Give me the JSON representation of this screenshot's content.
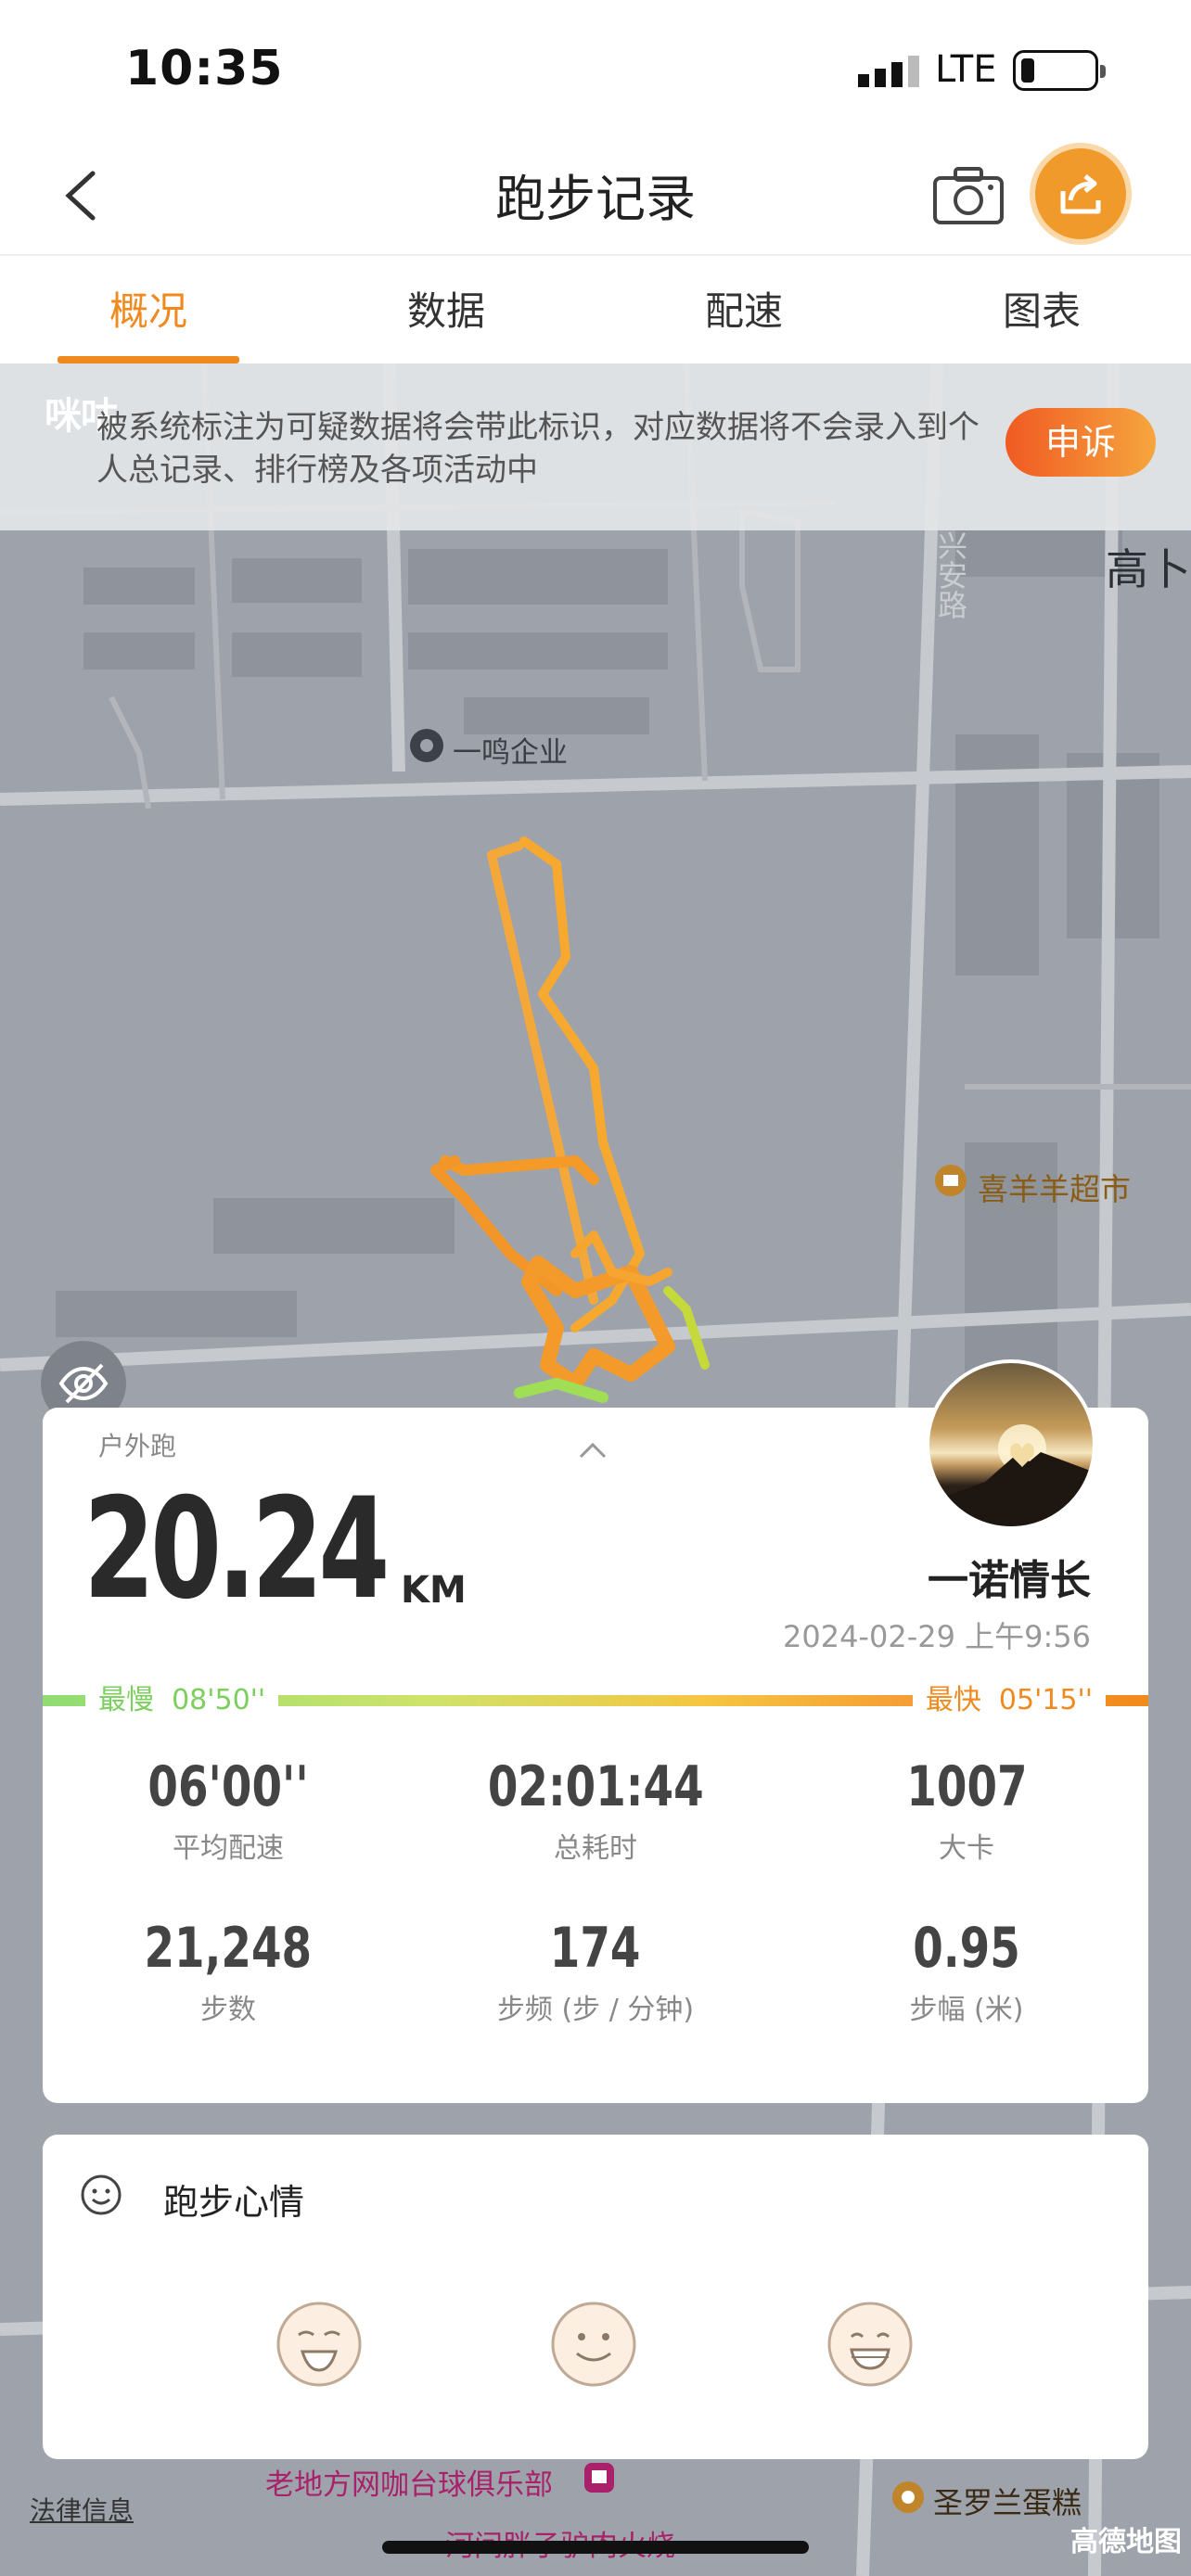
{
  "status": {
    "time": "10:35",
    "network": "LTE"
  },
  "nav": {
    "title": "跑步记录",
    "back_icon": "chevron-left-icon",
    "camera_icon": "camera-icon",
    "share_icon": "share-icon",
    "share_color": "#f19a2c"
  },
  "tabs": [
    {
      "label": "概况",
      "active": true
    },
    {
      "label": "数据"
    },
    {
      "label": "配速"
    },
    {
      "label": "图表"
    }
  ],
  "banner": {
    "watermark": "咪咕",
    "text": "被系统标注为可疑数据将会带此标识，对应数据将不会录入到个人总记录、排行榜及各项活动中",
    "appeal_label": "申诉"
  },
  "map": {
    "pois": {
      "company": "一鸣企业",
      "supermarket": "喜羊羊超市",
      "road": "兴安路",
      "area": "高卜",
      "club": "老地方网咖台球俱乐部",
      "bakery": "圣罗兰蛋糕",
      "restaurant": "河间胖子驴肉火烧"
    },
    "provider": "高德地图",
    "legal": "法律信息"
  },
  "summary": {
    "type": "户外跑",
    "distance": "20.24",
    "unit": "KM",
    "username": "一诺情长",
    "datetime": "2024-02-29 上午9:56",
    "slowest_label": "最慢",
    "slowest": "08'50''",
    "fastest_label": "最快",
    "fastest": "05'15''",
    "stats": [
      {
        "value": "06'00''",
        "label": "平均配速"
      },
      {
        "value": "02:01:44",
        "label": "总耗时"
      },
      {
        "value": "1007",
        "label": "大卡"
      },
      {
        "value": "21,248",
        "label": "步数"
      },
      {
        "value": "174",
        "label": "步频 (步 / 分钟)"
      },
      {
        "value": "0.95",
        "label": "步幅 (米)"
      }
    ]
  },
  "mood": {
    "title": "跑步心情",
    "faces": [
      "happy-face-icon",
      "smile-face-icon",
      "grin-face-icon"
    ]
  },
  "colors": {
    "accent": "#f08a1f",
    "slow": "#7ccf5c",
    "map": "#9ea3ab"
  }
}
